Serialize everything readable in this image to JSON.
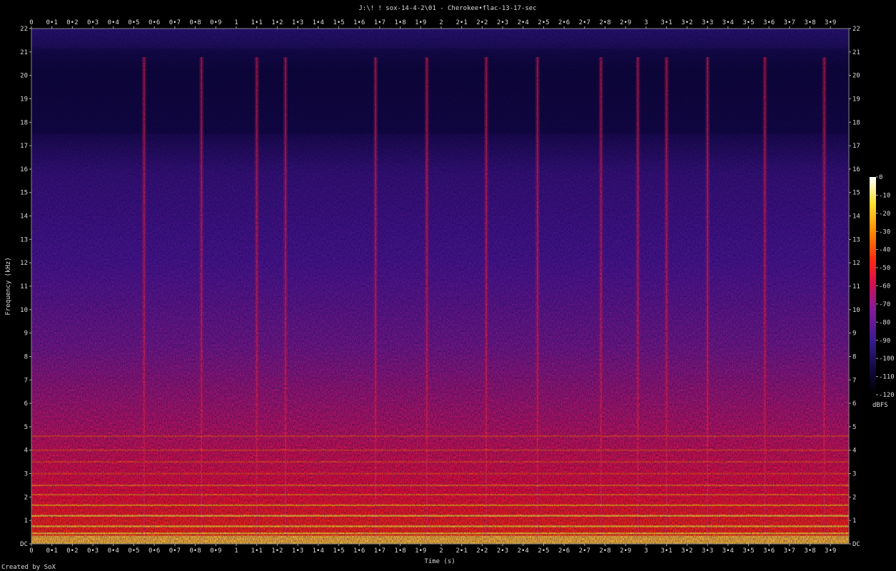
{
  "chart_data": {
    "type": "heatmap",
    "title": "J:\\! ! sox-14-4-2\\01 - Cherokee•flac-13-17-sec",
    "xlabel": "Time (s)",
    "ylabel": "Frequency (kHz)",
    "x_ticks": [
      "0",
      "0•1",
      "0•2",
      "0•3",
      "0•4",
      "0•5",
      "0•6",
      "0•7",
      "0•8",
      "0•9",
      "1",
      "1•1",
      "1•2",
      "1•3",
      "1•4",
      "1•5",
      "1•6",
      "1•7",
      "1•8",
      "1•9",
      "2",
      "2•1",
      "2•2",
      "2•3",
      "2•4",
      "2•5",
      "2•6",
      "2•7",
      "2•8",
      "2•9",
      "3",
      "3•1",
      "3•2",
      "3•3",
      "3•4",
      "3•5",
      "3•6",
      "3•7",
      "3•8",
      "3•9"
    ],
    "y_ticks": [
      "DC",
      "1",
      "2",
      "3",
      "4",
      "5",
      "6",
      "7",
      "8",
      "9",
      "10",
      "11",
      "12",
      "13",
      "14",
      "15",
      "16",
      "17",
      "18",
      "19",
      "20",
      "21",
      "22"
    ],
    "xlim": [
      0,
      3.99
    ],
    "ylim": [
      0,
      22
    ],
    "colorbar": {
      "label": "dBFS",
      "ticks": [
        "0",
        "-10",
        "-20",
        "-30",
        "-40",
        "-50",
        "-60",
        "-70",
        "-80",
        "-90",
        "-100",
        "-110",
        "-120"
      ],
      "range": [
        -120,
        0
      ]
    },
    "bright_band_cutoff_khz": 17.5,
    "transient_onsets_s": [
      0.55,
      0.83,
      1.1,
      1.24,
      1.68,
      1.93,
      2.22,
      2.47,
      2.78,
      2.96,
      3.1,
      3.3,
      3.58,
      3.87
    ],
    "harmonic_lines_khz": [
      0.45,
      0.75,
      1.2,
      1.65,
      2.1,
      2.5,
      3.0,
      3.5,
      4.0,
      4.6
    ],
    "colors": [
      "#000000",
      "#0d0830",
      "#2a1060",
      "#5a1890",
      "#a01888",
      "#e01040",
      "#ff3010",
      "#ff9000",
      "#ffe040",
      "#ffffff"
    ]
  },
  "footer": {
    "credit": "Created by SoX"
  }
}
